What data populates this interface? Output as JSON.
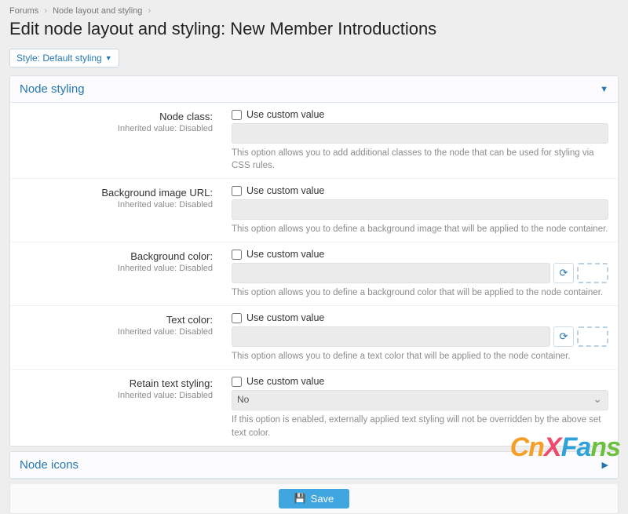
{
  "breadcrumbs": {
    "item1": "Forums",
    "item2": "Node layout and styling"
  },
  "page_title": "Edit node layout and styling: New Member Introductions",
  "style_button": "Style: Default styling",
  "sections": {
    "styling": {
      "title": "Node styling"
    },
    "icons": {
      "title": "Node icons"
    }
  },
  "common": {
    "use_custom": "Use custom value",
    "inherited": "Inherited value: Disabled"
  },
  "rows": {
    "node_class": {
      "label": "Node class:",
      "help": "This option allows you to add additional classes to the node that can be used for styling via CSS rules."
    },
    "bg_url": {
      "label": "Background image URL:",
      "help": "This option allows you to define a background image that will be applied to the node container."
    },
    "bg_color": {
      "label": "Background color:",
      "help": "This option allows you to define a background color that will be applied to the node container."
    },
    "text_color": {
      "label": "Text color:",
      "help": "This option allows you to define a text color that will be applied to the node container."
    },
    "retain": {
      "label": "Retain text styling:",
      "select_value": "No",
      "help": "If this option is enabled, externally applied text styling will not be overridden by the above set text color."
    }
  },
  "footer": {
    "save": "Save"
  },
  "watermark": {
    "c1": "C",
    "c2": "n",
    "c3": "X",
    "c4": "F",
    "c5": "a",
    "c6": "n",
    "c7": "s"
  }
}
